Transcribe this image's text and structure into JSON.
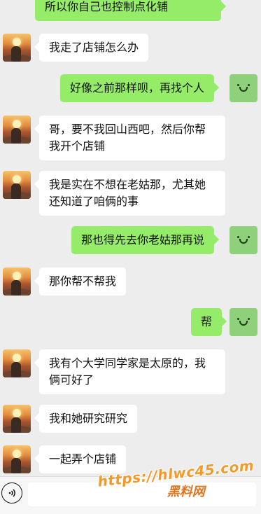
{
  "chat": {
    "messages": [
      {
        "side": "out",
        "text": "所以你自己也控制点化铺"
      },
      {
        "side": "in",
        "text": "我走了店铺怎么办"
      },
      {
        "side": "out",
        "text": "好像之前那样呗，再找个人"
      },
      {
        "side": "in",
        "text": "哥，要不我回山西吧，然后你帮我开个店铺"
      },
      {
        "side": "in",
        "text": "我是实在不想在老姑那，尤其她还知道了咱俩的事"
      },
      {
        "side": "out",
        "text": "那也得先去你老姑那再说"
      },
      {
        "side": "in",
        "text": "那你帮不帮我"
      },
      {
        "side": "out",
        "text": "帮"
      },
      {
        "side": "in",
        "text": "我有个大学同学家是太原的，我俩可好了"
      },
      {
        "side": "in",
        "text": "我和她研究研究"
      },
      {
        "side": "in",
        "text": "一起弄个店铺"
      }
    ]
  },
  "input_bar": {
    "voice_icon": "voice-wave-icon",
    "text_value": ""
  },
  "watermark": {
    "url": "https://hlwc45.com",
    "brand": "黑料网"
  },
  "colors": {
    "background": "#ededed",
    "bubble_in": "#ffffff",
    "bubble_out": "#95ec69",
    "watermark": "#f39a2b"
  }
}
